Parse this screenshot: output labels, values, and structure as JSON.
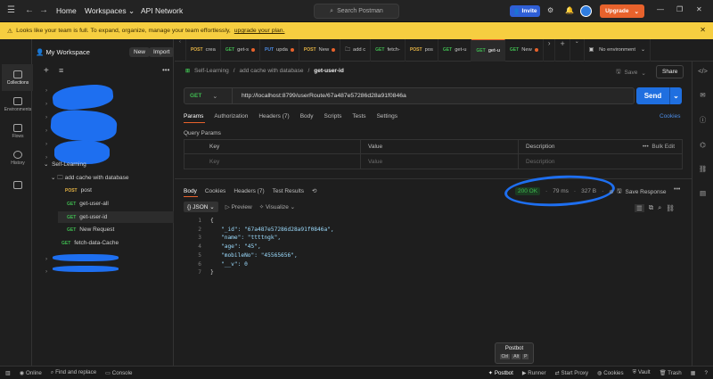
{
  "topbar": {
    "nav": [
      "Home",
      "Workspaces",
      "API Network"
    ],
    "search_placeholder": "Search Postman",
    "invite": "Invite",
    "upgrade": "Upgrade"
  },
  "banner": {
    "text": "Looks like your team is full. To expand, organize, manage your team effortlessly,",
    "link": "upgrade your plan."
  },
  "rail": {
    "items": [
      "Collections",
      "Environments",
      "Flows",
      "History"
    ]
  },
  "sidebar": {
    "workspace": "My Workspace",
    "new": "New",
    "import": "Import",
    "tree": {
      "collection": "Self-Learning",
      "folder": "add cache with database",
      "requests": [
        {
          "method": "POST",
          "name": "post"
        },
        {
          "method": "GET",
          "name": "get-user-all"
        },
        {
          "method": "GET",
          "name": "get-user-id"
        },
        {
          "method": "GET",
          "name": "New Request"
        }
      ],
      "extra": {
        "method": "GET",
        "name": "fetch-data-Cache"
      }
    }
  },
  "tabs": {
    "items": [
      {
        "method": "POST",
        "label": "crea"
      },
      {
        "method": "GET",
        "label": "get-s"
      },
      {
        "method": "PUT",
        "label": "upda"
      },
      {
        "method": "POST",
        "label": "New"
      },
      {
        "method": "",
        "label": "add c"
      },
      {
        "method": "GET",
        "label": "fetch-"
      },
      {
        "method": "POST",
        "label": "pos"
      },
      {
        "method": "GET",
        "label": "get-u"
      },
      {
        "method": "GET",
        "label": "get-u"
      },
      {
        "method": "GET",
        "label": "New"
      }
    ],
    "environment": "No environment"
  },
  "request": {
    "breadcrumb": [
      "Self-Learning",
      "add cache with database"
    ],
    "name": "get-user-id",
    "save": "Save",
    "share": "Share",
    "method": "GET",
    "url": "http://localhost:8799/userRoute/67a487e57286d28a91f0846a",
    "send": "Send",
    "tabs": [
      "Params",
      "Authorization",
      "Headers (7)",
      "Body",
      "Scripts",
      "Tests",
      "Settings"
    ],
    "cookies": "Cookies",
    "query_params_title": "Query Params",
    "columns": [
      "Key",
      "Value",
      "Description"
    ],
    "bulk_edit": "Bulk Edit",
    "placeholders": {
      "key": "Key",
      "value": "Value",
      "description": "Description"
    }
  },
  "response": {
    "tabs": [
      "Body",
      "Cookies",
      "Headers (7)",
      "Test Results"
    ],
    "status": "200 OK",
    "time": "79 ms",
    "size": "327 B",
    "save_response": "Save Response",
    "format": "JSON",
    "preview": "Preview",
    "visualize": "Visualize",
    "lines": [
      [
        "1",
        "{"
      ],
      [
        "2",
        "\"_id\": \"67a487e57286d28a91f0846a\","
      ],
      [
        "3",
        "\"name\": \"ttttngk\","
      ],
      [
        "4",
        "\"age\": \"45\","
      ],
      [
        "5",
        "\"mobileNo\": \"45565656\","
      ],
      [
        "6",
        "\"__v\": 0"
      ],
      [
        "7",
        "}"
      ]
    ]
  },
  "postbot_popup": {
    "title": "Postbot",
    "keys": [
      "Ctrl",
      "Alt",
      "P"
    ]
  },
  "status": {
    "left": [
      "Online",
      "Find and replace",
      "Console"
    ],
    "right": [
      "Postbot",
      "Runner",
      "Start Proxy",
      "Cookies",
      "Vault",
      "Trash"
    ]
  }
}
